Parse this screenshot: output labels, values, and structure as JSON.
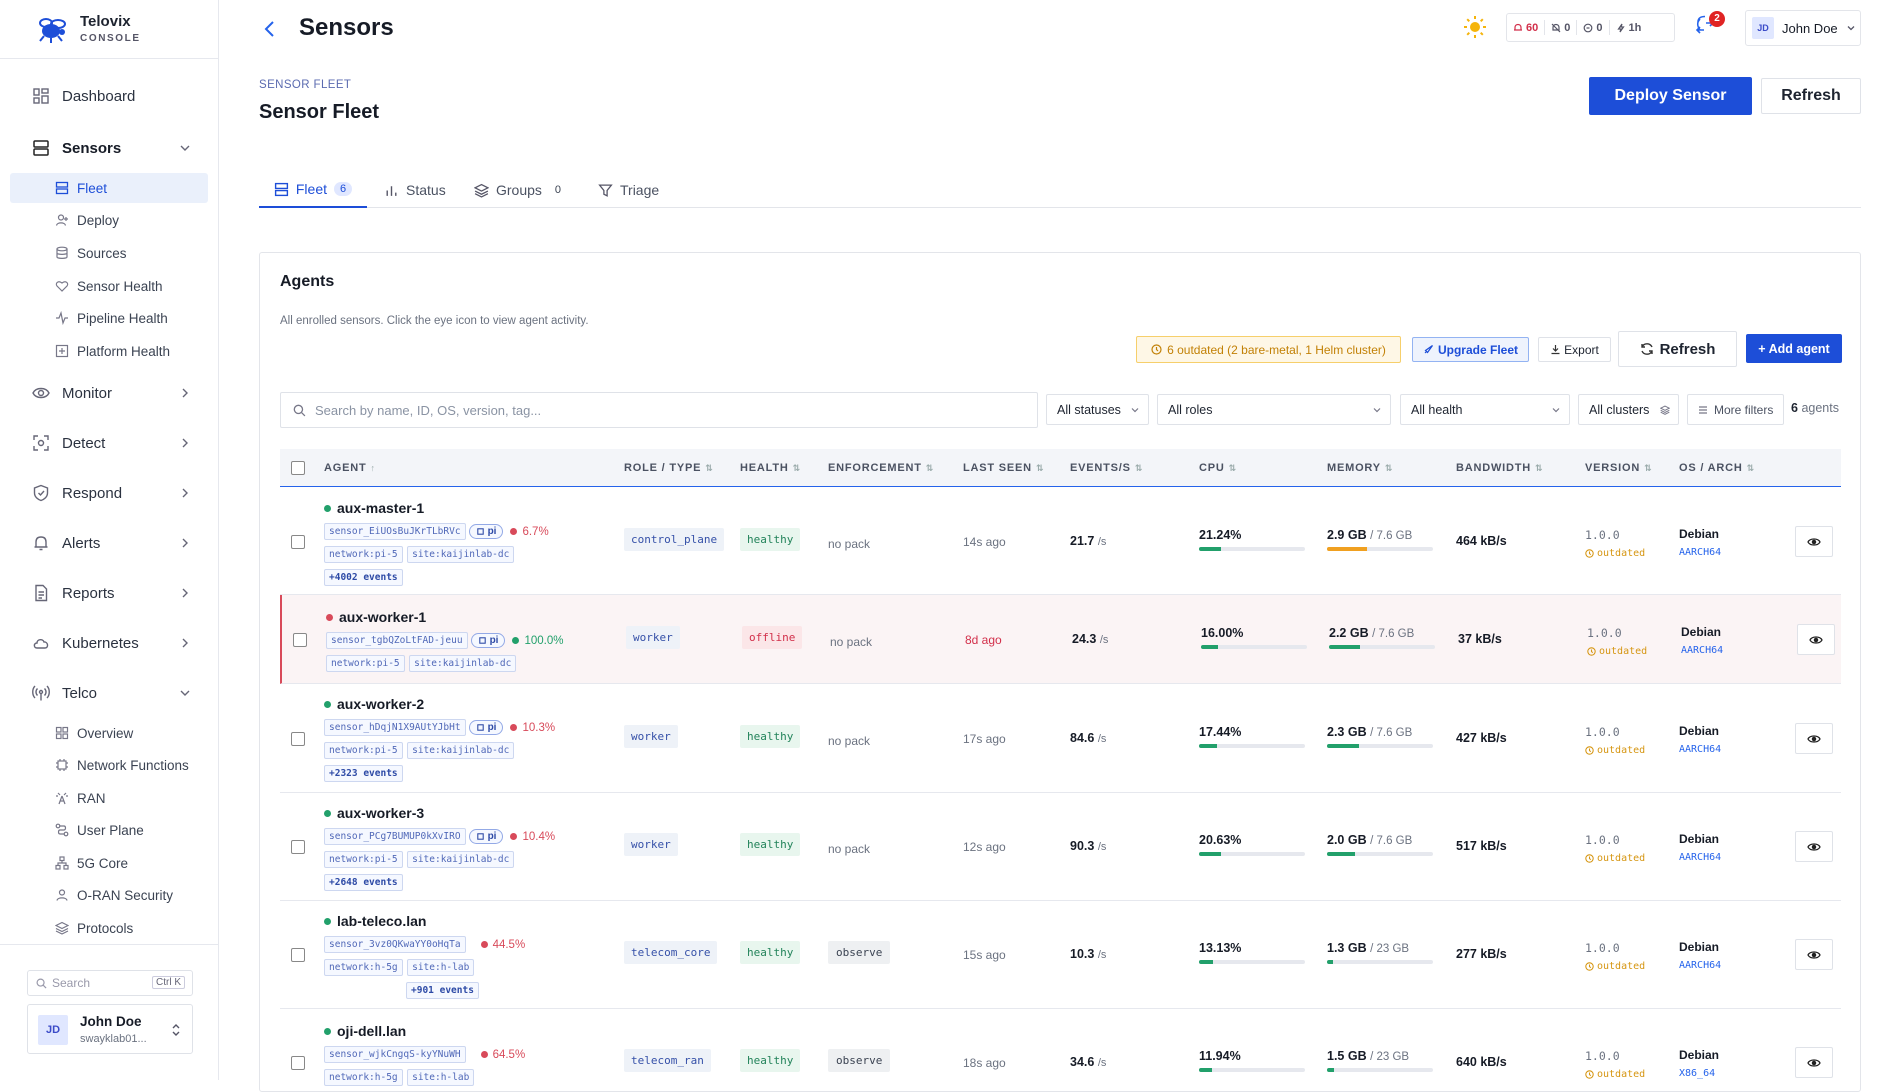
{
  "app": {
    "name": "Telovix",
    "sub": "CONSOLE"
  },
  "sidebar": {
    "dashboard": "Dashboard",
    "sensors": "Sensors",
    "sensor_sub": [
      "Fleet",
      "Deploy",
      "Sources",
      "Sensor Health",
      "Pipeline Health",
      "Platform Health"
    ],
    "monitor": "Monitor",
    "detect": "Detect",
    "respond": "Respond",
    "alerts": "Alerts",
    "reports": "Reports",
    "kubernetes": "Kubernetes",
    "telco": "Telco",
    "telco_sub": [
      "Overview",
      "Network Functions",
      "RAN",
      "User Plane",
      "5G Core",
      "O-RAN Security",
      "Protocols"
    ],
    "search_placeholder": "Search",
    "search_kbd": "Ctrl K",
    "user_initials": "JD",
    "user_name": "John Doe",
    "user_org": "swayklab01..."
  },
  "header": {
    "title": "Sensors",
    "stats": {
      "alerts": "60",
      "s2": "0",
      "s3": "0",
      "range": "1h"
    },
    "notif_count": "2",
    "user_initials": "JD",
    "user_name": "John Doe"
  },
  "page": {
    "crumb": "SENSOR FLEET",
    "title": "Sensor Fleet",
    "deploy_label": "Deploy Sensor",
    "refresh_label": "Refresh",
    "tabs": [
      {
        "label": "Fleet",
        "count": "6"
      },
      {
        "label": "Status"
      },
      {
        "label": "Groups",
        "count": "0"
      },
      {
        "label": "Triage"
      }
    ]
  },
  "agents": {
    "title": "Agents",
    "desc": "All enrolled sensors. Click the eye icon to view agent activity.",
    "outdated": "6 outdated (2 bare-metal, 1 Helm cluster)",
    "upgrade": "Upgrade Fleet",
    "export": "Export",
    "refresh": "Refresh",
    "add": "+ Add agent",
    "search_placeholder": "Search by name, ID, OS, version, tag...",
    "filters": {
      "status": "All statuses",
      "roles": "All roles",
      "health": "All health",
      "clusters": "All clusters",
      "more": "More filters"
    },
    "count_num": "6",
    "count_label": "agents",
    "columns": [
      "AGENT",
      "ROLE / TYPE",
      "HEALTH",
      "ENFORCEMENT",
      "LAST SEEN",
      "EVENTS/S",
      "CPU",
      "MEMORY",
      "BANDWIDTH",
      "VERSION",
      "OS / ARCH"
    ],
    "unit_s": "/s",
    "rows": [
      {
        "name": "aux-master-1",
        "id": "sensor_EiUOsBuJKrTLbRVc",
        "pi": "pi",
        "pct": "6.7%",
        "tags": [
          "network:pi-5",
          "site:kaijinlab-dc"
        ],
        "events": "+4002 events",
        "role": "control_plane",
        "health": "healthy",
        "enf": "no pack",
        "seen": "14s ago",
        "eps": "21.7",
        "cpu": "21.24%",
        "cpu_frac": 0.21,
        "mem": "2.9 GB",
        "mem_total": "/ 7.6 GB",
        "mem_frac": 0.38,
        "bw": "464 kB/s",
        "ver": "1.0.0",
        "outdated": "outdated",
        "os": "Debian",
        "arch": "AARCH64"
      },
      {
        "name": "aux-worker-1",
        "id": "sensor_tgbQZoLtFAD-jeuu",
        "pi": "pi",
        "pct": "100.0%",
        "tags": [
          "network:pi-5",
          "site:kaijinlab-dc"
        ],
        "events": "",
        "role": "worker",
        "health": "offline",
        "enf": "no pack",
        "seen": "8d ago",
        "eps": "24.3",
        "cpu": "16.00%",
        "cpu_frac": 0.16,
        "mem": "2.2 GB",
        "mem_total": "/ 7.6 GB",
        "mem_frac": 0.29,
        "bw": "37 kB/s",
        "ver": "1.0.0",
        "outdated": "outdated",
        "os": "Debian",
        "arch": "AARCH64"
      },
      {
        "name": "aux-worker-2",
        "id": "sensor_hDqjN1X9AUtYJbHt",
        "pi": "pi",
        "pct": "10.3%",
        "tags": [
          "network:pi-5",
          "site:kaijinlab-dc"
        ],
        "events": "+2323 events",
        "role": "worker",
        "health": "healthy",
        "enf": "no pack",
        "seen": "17s ago",
        "eps": "84.6",
        "cpu": "17.44%",
        "cpu_frac": 0.17,
        "mem": "2.3 GB",
        "mem_total": "/ 7.6 GB",
        "mem_frac": 0.3,
        "bw": "427 kB/s",
        "ver": "1.0.0",
        "outdated": "outdated",
        "os": "Debian",
        "arch": "AARCH64"
      },
      {
        "name": "aux-worker-3",
        "id": "sensor_PCg7BUMUP0kXvIRO",
        "pi": "pi",
        "pct": "10.4%",
        "tags": [
          "network:pi-5",
          "site:kaijinlab-dc"
        ],
        "events": "+2648 events",
        "role": "worker",
        "health": "healthy",
        "enf": "no pack",
        "seen": "12s ago",
        "eps": "90.3",
        "cpu": "20.63%",
        "cpu_frac": 0.21,
        "mem": "2.0 GB",
        "mem_total": "/ 7.6 GB",
        "mem_frac": 0.26,
        "bw": "517 kB/s",
        "ver": "1.0.0",
        "outdated": "outdated",
        "os": "Debian",
        "arch": "AARCH64"
      },
      {
        "name": "lab-teleco.lan",
        "id": "sensor_3vz0QKwaYY0oHqTa",
        "pi": "",
        "pct": "44.5%",
        "tags": [
          "network:h-5g",
          "site:h-lab"
        ],
        "events": "+901 events",
        "role": "telecom_core",
        "health": "healthy",
        "enf": "observe",
        "seen": "15s ago",
        "eps": "10.3",
        "cpu": "13.13%",
        "cpu_frac": 0.13,
        "mem": "1.3 GB",
        "mem_total": "/ 23 GB",
        "mem_frac": 0.06,
        "bw": "277 kB/s",
        "ver": "1.0.0",
        "outdated": "outdated",
        "os": "Debian",
        "arch": "AARCH64"
      },
      {
        "name": "oji-dell.lan",
        "id": "sensor_wjkCngqS-kyYNuWH",
        "pi": "",
        "pct": "64.5%",
        "tags": [
          "network:h-5g",
          "site:h-lab"
        ],
        "events": "",
        "role": "telecom_ran",
        "health": "healthy",
        "enf": "observe",
        "seen": "18s ago",
        "eps": "34.6",
        "cpu": "11.94%",
        "cpu_frac": 0.12,
        "mem": "1.5 GB",
        "mem_total": "/ 23 GB",
        "mem_frac": 0.07,
        "bw": "640 kB/s",
        "ver": "1.0.0",
        "outdated": "outdated",
        "os": "Debian",
        "arch": "X86_64"
      }
    ]
  },
  "colors": {
    "accent": "#1d4ed8",
    "healthy": "#22a06b",
    "offline": "#d84a5a",
    "warn": "#d69612"
  }
}
